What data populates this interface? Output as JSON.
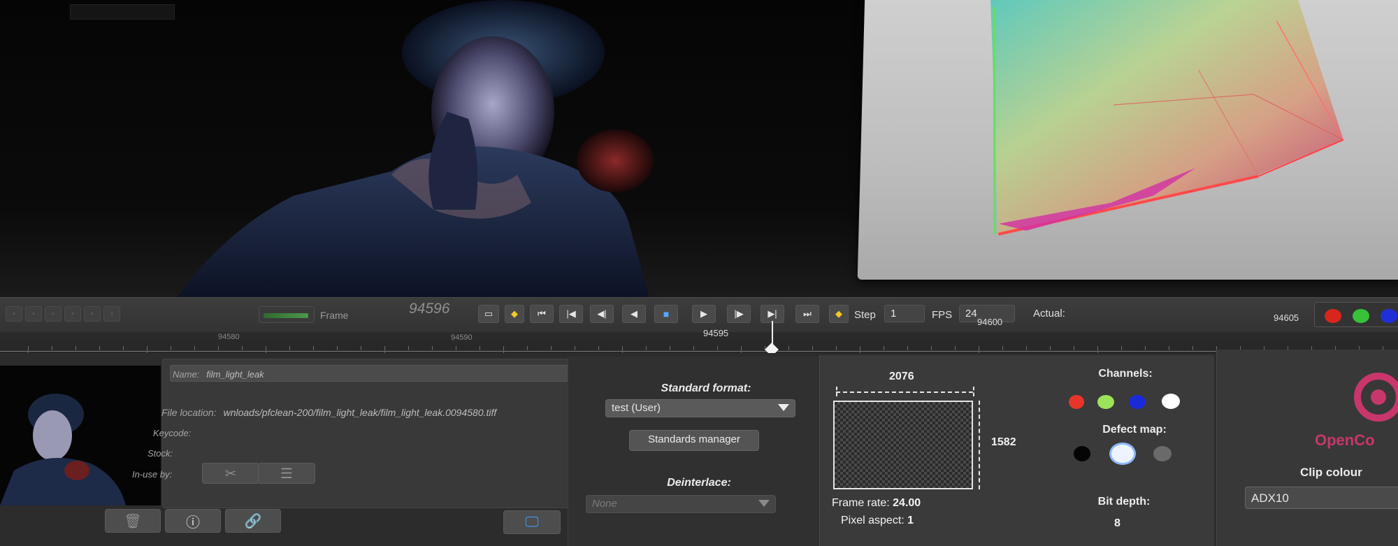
{
  "transport": {
    "frame_label": "Frame",
    "frame_number": "94596",
    "step_label": "Step",
    "step_value": "1",
    "fps_label": "FPS",
    "fps_value": "24",
    "actual_label": "Actual:",
    "buttons": [
      "viewer-toggle",
      "set-key",
      "go-start",
      "prev-key",
      "step-back",
      "play-reverse",
      "stop",
      "play",
      "step-forward",
      "next-key",
      "go-end",
      "key-next"
    ]
  },
  "channels_top": {
    "colors": [
      "#d9261c",
      "#37c237",
      "#2030d8"
    ]
  },
  "timeline": {
    "labels": [
      {
        "text": "94580",
        "dim": true
      },
      {
        "text": "94590",
        "dim": true
      },
      {
        "text": "94595",
        "dim": false
      },
      {
        "text": "94600",
        "dim": false
      },
      {
        "text": "94605",
        "dim": false
      }
    ],
    "current_frame": "94596"
  },
  "clip_info": {
    "name_label": "Name:",
    "name_value": "film_light_leak",
    "location_label": "File location:",
    "location_value": "wnloads/pfclean-200/film_light_leak/film_light_leak.0094580.tiff",
    "keycode_label": "Keycode:",
    "stock_label": "Stock:",
    "in_use_label": "In-use by:"
  },
  "format": {
    "standard_format_label": "Standard format:",
    "standard_format_value": "test (User)",
    "standards_manager_label": "Standards manager",
    "deinterlace_label": "Deinterlace:",
    "deinterlace_value": "None"
  },
  "resolution": {
    "width": "2076",
    "height": "1582",
    "frame_rate_label": "Frame rate:",
    "frame_rate_value": "24.00",
    "pixel_aspect_label": "Pixel aspect:",
    "pixel_aspect_value": "1"
  },
  "channels": {
    "title": "Channels:",
    "colors": [
      "#e8352b",
      "#9be35a",
      "#1a2ad8",
      "#ffffff"
    ],
    "defect_map_title": "Defect map:",
    "defect_colors": [
      "#050505",
      "#eef4ff",
      "#6a6a6a"
    ],
    "bit_depth_label": "Bit depth:",
    "bit_depth_value": "8"
  },
  "ocio": {
    "logo_text": "OpenCo",
    "clip_colour_label": "Clip colour",
    "clip_colour_value": "ADX10",
    "accent": "#c9366b"
  }
}
